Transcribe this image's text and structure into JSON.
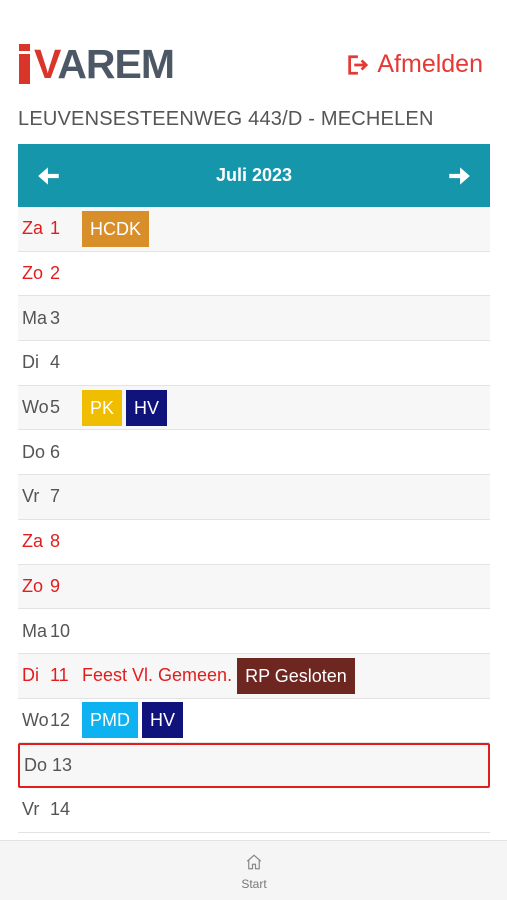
{
  "logo": {
    "text_red": "V",
    "text_gray": "AREM",
    "alt": "IVAREM"
  },
  "logout": {
    "label": "Afmelden",
    "icon": "logout-icon",
    "color": "#e53935"
  },
  "address": "LEUVENSESTEENWEG 443/D - MECHELEN",
  "calendar": {
    "month_label": "Juli 2023",
    "header_color": "#1696aa",
    "prev_icon": "arrow-left-icon",
    "next_icon": "arrow-right-icon",
    "days": [
      {
        "name": "Za",
        "num": "1",
        "type": "weekend",
        "holiday": "",
        "tags": [
          "HCDK"
        ]
      },
      {
        "name": "Zo",
        "num": "2",
        "type": "weekend",
        "holiday": "",
        "tags": []
      },
      {
        "name": "Ma",
        "num": "3",
        "type": "weekday",
        "holiday": "",
        "tags": []
      },
      {
        "name": "Di",
        "num": "4",
        "type": "weekday",
        "holiday": "",
        "tags": []
      },
      {
        "name": "Wo",
        "num": "5",
        "type": "weekday",
        "holiday": "",
        "tags": [
          "PK",
          "HV"
        ]
      },
      {
        "name": "Do",
        "num": "6",
        "type": "weekday",
        "holiday": "",
        "tags": []
      },
      {
        "name": "Vr",
        "num": "7",
        "type": "weekday",
        "holiday": "",
        "tags": []
      },
      {
        "name": "Za",
        "num": "8",
        "type": "weekend",
        "holiday": "",
        "tags": []
      },
      {
        "name": "Zo",
        "num": "9",
        "type": "weekend",
        "holiday": "",
        "tags": []
      },
      {
        "name": "Ma",
        "num": "10",
        "type": "weekday",
        "holiday": "",
        "tags": []
      },
      {
        "name": "Di",
        "num": "11",
        "type": "holiday",
        "holiday": "Feest Vl. Gemeen.",
        "tags": [
          "RP Gesloten"
        ]
      },
      {
        "name": "Wo",
        "num": "12",
        "type": "weekday",
        "holiday": "",
        "tags": [
          "PMD",
          "HV"
        ]
      },
      {
        "name": "Do",
        "num": "13",
        "type": "today",
        "holiday": "",
        "tags": []
      },
      {
        "name": "Vr",
        "num": "14",
        "type": "weekday",
        "holiday": "",
        "tags": []
      }
    ]
  },
  "tag_colors": {
    "HCDK": "#d88f2a",
    "PK": "#f0be00",
    "HV": "#11137c",
    "PMD": "#0fb2f0",
    "RP Gesloten": "#6d2620"
  },
  "bottom_nav": {
    "start_label": "Start",
    "start_icon": "home-icon"
  }
}
